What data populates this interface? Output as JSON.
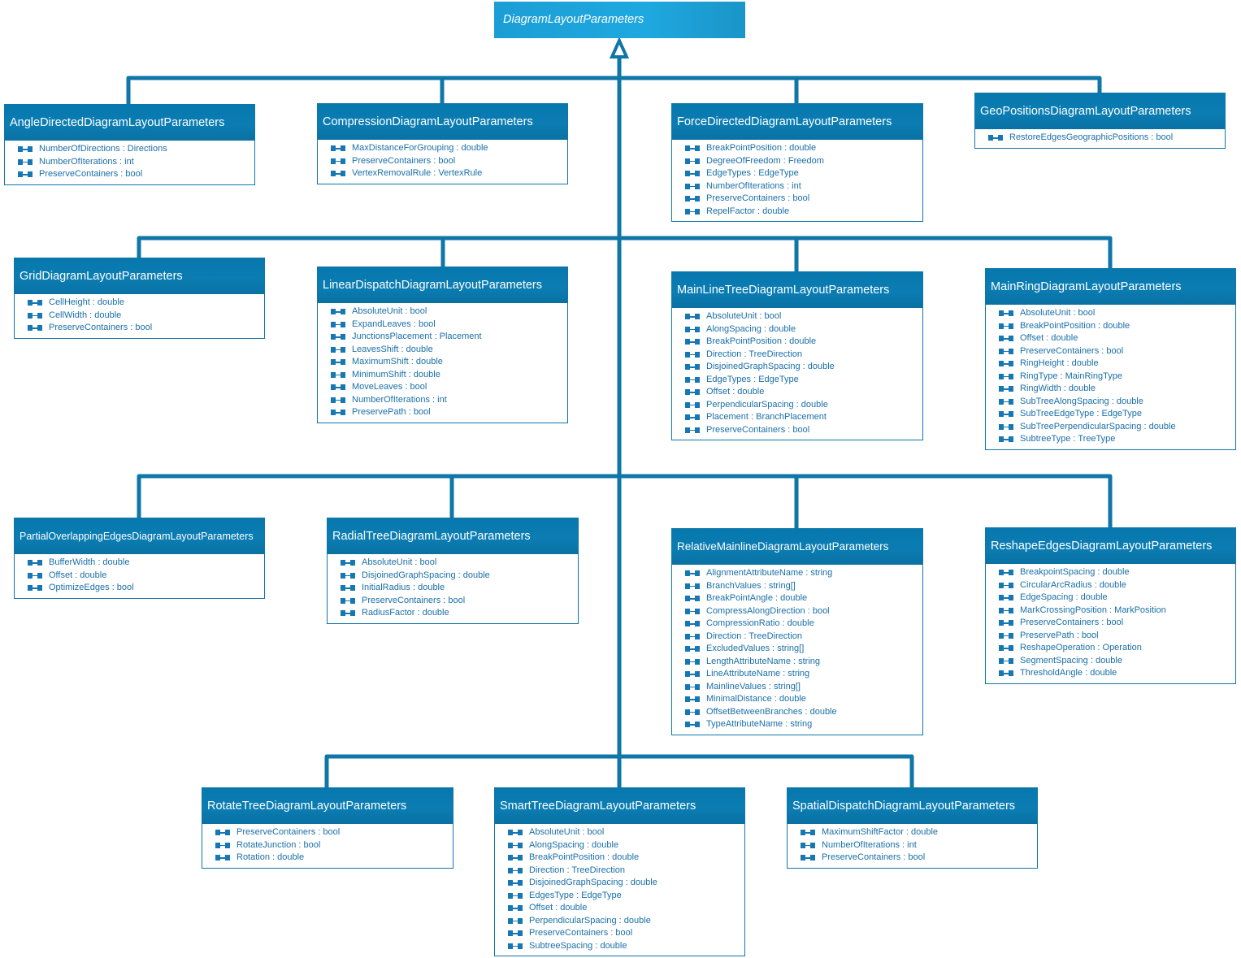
{
  "diagram": {
    "base_class": "DiagramLayoutParameters",
    "colors": {
      "accent": "#0b7db3",
      "root": "#1fa8e0",
      "connector": "#0f76a8",
      "property_text": "#1a6fa8"
    },
    "property_icon": "property-icon",
    "classes": [
      {
        "name": "AngleDirectedDiagramLayoutParameters",
        "properties": [
          "NumberOfDirections : Directions",
          "NumberOfIterations : int",
          "PreserveContainers : bool"
        ]
      },
      {
        "name": "CompressionDiagramLayoutParameters",
        "properties": [
          "MaxDistanceForGrouping : double",
          "PreserveContainers : bool",
          "VertexRemovalRule : VertexRule"
        ]
      },
      {
        "name": "ForceDirectedDiagramLayoutParameters",
        "properties": [
          "BreakPointPosition : double",
          "DegreeOfFreedom : Freedom",
          "EdgeTypes : EdgeType",
          "NumberOfIterations : int",
          "PreserveContainers : bool",
          "RepelFactor : double"
        ]
      },
      {
        "name": "GeoPositionsDiagramLayoutParameters",
        "properties": [
          "RestoreEdgesGeographicPositions : bool"
        ]
      },
      {
        "name": "GridDiagramLayoutParameters",
        "properties": [
          "CellHeight : double",
          "CellWidth : double",
          "PreserveContainers : bool"
        ]
      },
      {
        "name": "LinearDispatchDiagramLayoutParameters",
        "properties": [
          "AbsoluteUnit : bool",
          "ExpandLeaves : bool",
          "JunctionsPlacement : Placement",
          "LeavesShift : double",
          "MaximumShift : double",
          "MinimumShift : double",
          "MoveLeaves : bool",
          "NumberOfIterations : int",
          "PreservePath : bool"
        ]
      },
      {
        "name": "MainLineTreeDiagramLayoutParameters",
        "properties": [
          "AbsoluteUnit : bool",
          "AlongSpacing : double",
          "BreakPointPosition : double",
          "Direction : TreeDirection",
          "DisjoinedGraphSpacing : double",
          "EdgeTypes : EdgeType",
          "Offset : double",
          "PerpendicularSpacing : double",
          "Placement : BranchPlacement",
          "PreserveContainers : bool"
        ]
      },
      {
        "name": "MainRingDiagramLayoutParameters",
        "properties": [
          "AbsoluteUnit : bool",
          "BreakPointPosition : double",
          "Offset : double",
          "PreserveContainers : bool",
          "RingHeight : double",
          "RingType : MainRingType",
          "RingWidth : double",
          "SubTreeAlongSpacing : double",
          "SubTreeEdgeType : EdgeType",
          "SubTreePerpendicularSpacing : double",
          "SubtreeType : TreeType"
        ]
      },
      {
        "name": "PartialOverlappingEdgesDiagramLayoutParameters",
        "properties": [
          "BufferWidth : double",
          "Offset : double",
          "OptimizeEdges : bool"
        ]
      },
      {
        "name": "RadialTreeDiagramLayoutParameters",
        "properties": [
          "AbsoluteUnit : bool",
          "DisjoinedGraphSpacing : double",
          "InitialRadius : double",
          "PreserveContainers : bool",
          "RadiusFactor : double"
        ]
      },
      {
        "name": "RelativeMainlineDiagramLayoutParameters",
        "properties": [
          "AlignmentAttributeName : string",
          "BranchValues : string[]",
          "BreakPointAngle : double",
          "CompressAlongDirection : bool",
          "CompressionRatio : double",
          "Direction : TreeDirection",
          "ExcludedValues : string[]",
          "LengthAttributeName : string",
          "LineAttributeName : string",
          "MainlineValues : string[]",
          "MinimalDistance : double",
          "OffsetBetweenBranches : double",
          "TypeAttributeName : string"
        ]
      },
      {
        "name": "ReshapeEdgesDiagramLayoutParameters",
        "properties": [
          "BreakpointSpacing : double",
          "CircularArcRadius : double",
          "EdgeSpacing : double",
          "MarkCrossingPosition : MarkPosition",
          "PreserveContainers : bool",
          "PreservePath : bool",
          "ReshapeOperation : Operation",
          "SegmentSpacing : double",
          "ThresholdAngle : double"
        ]
      },
      {
        "name": "RotateTreeDiagramLayoutParameters",
        "properties": [
          "PreserveContainers : bool",
          "RotateJunction : bool",
          "Rotation : double"
        ]
      },
      {
        "name": "SmartTreeDiagramLayoutParameters",
        "properties": [
          "AbsoluteUnit : bool",
          "AlongSpacing : double",
          "BreakPointPosition : double",
          "Direction : TreeDirection",
          "DisjoinedGraphSpacing : double",
          "EdgesType : EdgeType",
          "Offset : double",
          "PerpendicularSpacing : double",
          "PreserveContainers : bool",
          "SubtreeSpacing : double"
        ]
      },
      {
        "name": "SpatialDispatchDiagramLayoutParameters",
        "properties": [
          "MaximumShiftFactor : double",
          "NumberOfIterations : int",
          "PreserveContainers : bool"
        ]
      }
    ]
  }
}
